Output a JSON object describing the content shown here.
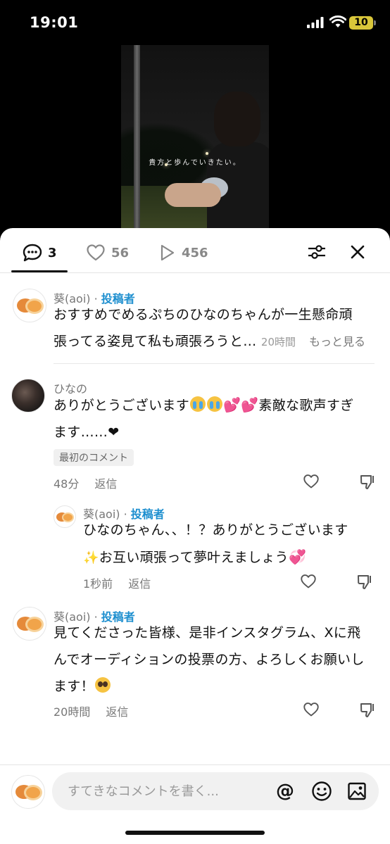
{
  "status_bar": {
    "time": "19:01",
    "battery": "10"
  },
  "video": {
    "caption": "貴方と歩んでいきたい。"
  },
  "tabs": {
    "comments": "3",
    "likes": "56",
    "views": "456"
  },
  "comments": [
    {
      "name": "葵(aoi)",
      "badge": "投稿者",
      "line1": "おすすめでめるぷちのひなのちゃんが一生懸命頑",
      "line2": "張ってる姿見て私も頑張ろうと…",
      "time": "20時間",
      "more": "もっと見る"
    },
    {
      "name": "ひなの",
      "line1_a": "ありがとうございます",
      "line1_b": "素敵な歌声すぎ",
      "line2": "ます……❤",
      "chip": "最初のコメント",
      "time": "48分",
      "reply": "返信"
    },
    {
      "name": "葵(aoi)",
      "badge": "投稿者",
      "line1": "ひなのちゃん、、！？ありがとうございます",
      "line2": "お互い頑張って夢叶えましょう",
      "time": "1秒前",
      "reply": "返信"
    },
    {
      "name": "葵(aoi)",
      "badge": "投稿者",
      "line1": "見てくださった皆様、是非インスタグラム、Xに飛",
      "line2": "んでオーディションの投票の方、よろしくお願いし",
      "line3": "ます！",
      "time": "20時間",
      "reply": "返信"
    }
  ],
  "composer": {
    "placeholder": "すてきなコメントを書く..."
  },
  "colors": {
    "author_blue": "#1e8fcf",
    "accent_heart": "#e64aa6"
  }
}
